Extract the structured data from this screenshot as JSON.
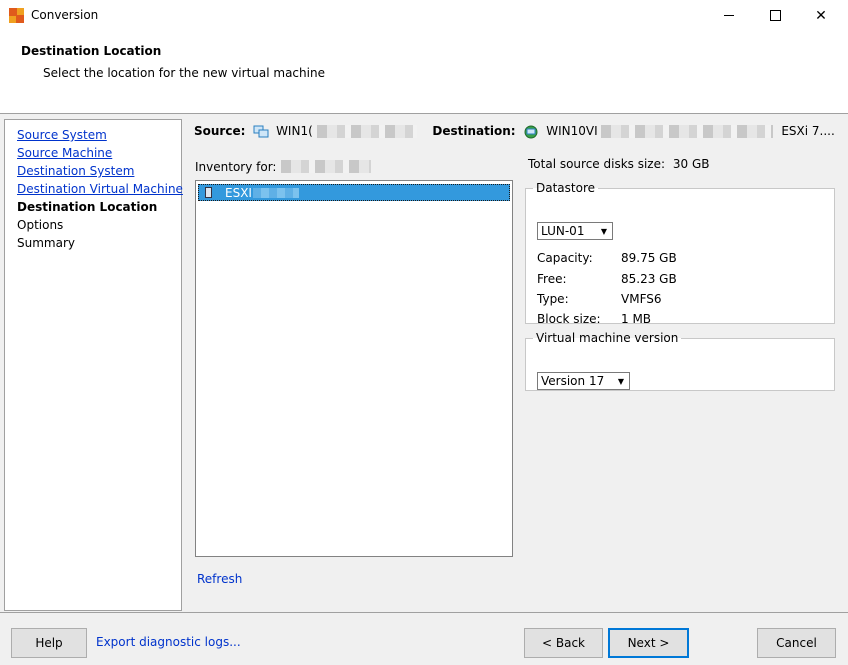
{
  "window": {
    "title": "Conversion",
    "icons": {
      "app": "vmware-converter-icon",
      "minimize": "minimize-icon",
      "maximize": "maximize-icon",
      "close": "close-icon"
    },
    "close_glyph": "✕"
  },
  "header": {
    "title": "Destination Location",
    "subtitle": "Select the location for the new virtual machine"
  },
  "nav": {
    "items": [
      {
        "label": "Source System",
        "state": "link"
      },
      {
        "label": "Source Machine",
        "state": "link"
      },
      {
        "label": "Destination System",
        "state": "link"
      },
      {
        "label": "Destination Virtual Machine",
        "state": "link"
      },
      {
        "label": "Destination Location",
        "state": "current"
      },
      {
        "label": "Options",
        "state": "disabled"
      },
      {
        "label": "Summary",
        "state": "disabled"
      }
    ]
  },
  "connection": {
    "source_label": "Source:",
    "source_value": "WIN1(",
    "destination_label": "Destination:",
    "destination_value": "WIN10VI",
    "destination_tail": "ESXi 7...."
  },
  "inventory": {
    "label": "Inventory for:",
    "selected_item": "ESXI",
    "refresh_label": "Refresh"
  },
  "disk": {
    "total_label": "Total source disks size:",
    "total_value": "30 GB"
  },
  "datastore": {
    "legend": "Datastore",
    "selected": "LUN-01",
    "capacity_label": "Capacity:",
    "capacity_value": "89.75 GB",
    "free_label": "Free:",
    "free_value": "85.23 GB",
    "type_label": "Type:",
    "type_value": "VMFS6",
    "block_label": "Block size:",
    "block_value": "1 MB"
  },
  "vm_version": {
    "legend": "Virtual machine version",
    "selected": "Version 17"
  },
  "footer": {
    "help": "Help",
    "export": "Export diagnostic logs...",
    "back": "< Back",
    "next": "Next >",
    "cancel": "Cancel"
  },
  "colors": {
    "accent": "#0078d7",
    "link": "#0033cc",
    "selection": "#3399dd"
  }
}
